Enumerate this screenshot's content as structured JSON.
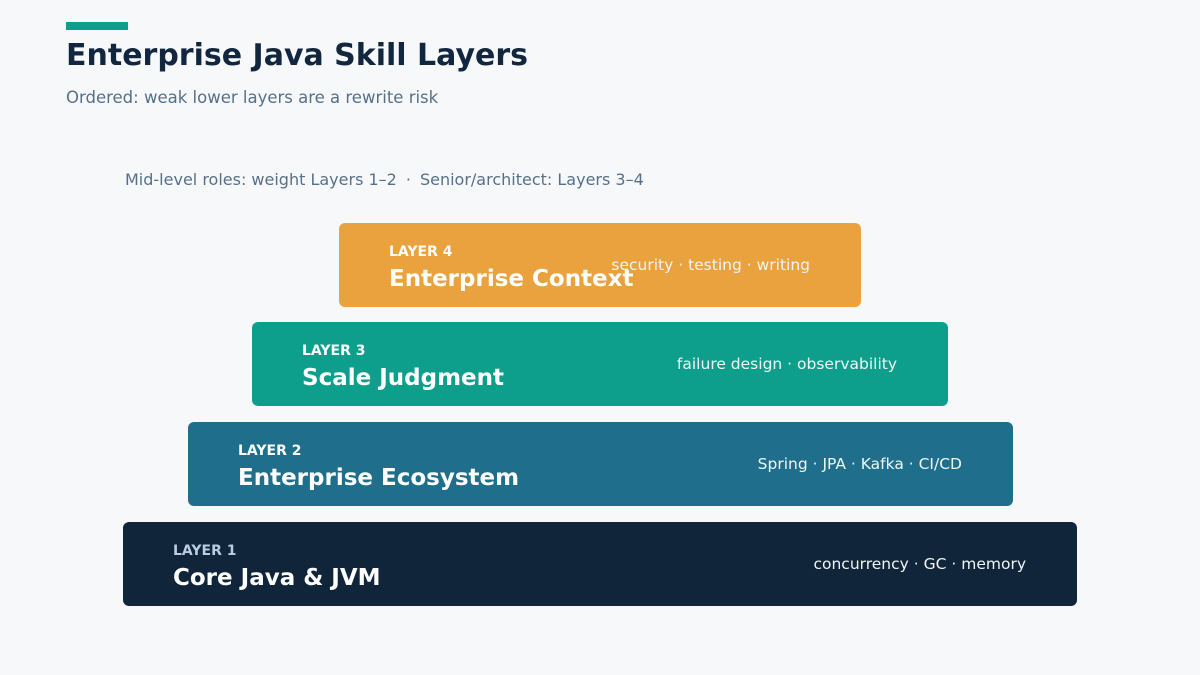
{
  "header": {
    "title": "Enterprise Java Skill Layers",
    "subtitle": "Ordered: weak lower layers are a rewrite risk"
  },
  "note": {
    "mid_level": "Mid-level roles: weight Layers 1–2",
    "separator": "·",
    "senior": "Senior/architect: Layers 3–4"
  },
  "layers": [
    {
      "tag": "LAYER 4",
      "name": "Enterprise Context",
      "detail": "security · testing · writing",
      "color": "#e9a23e"
    },
    {
      "tag": "LAYER 3",
      "name": "Scale Judgment",
      "detail": "failure design · observability",
      "color": "#0e9f8c"
    },
    {
      "tag": "LAYER 2",
      "name": "Enterprise Ecosystem",
      "detail": "Spring · JPA · Kafka · CI/CD",
      "color": "#1f6f8c"
    },
    {
      "tag": "LAYER 1",
      "name": "Core Java & JVM",
      "detail": "concurrency · GC · memory",
      "color": "#10243a"
    }
  ],
  "colors": {
    "accent": "#0e9f8c",
    "background": "#f6f8fa",
    "title_text": "#12263f",
    "muted_text": "#577089"
  }
}
